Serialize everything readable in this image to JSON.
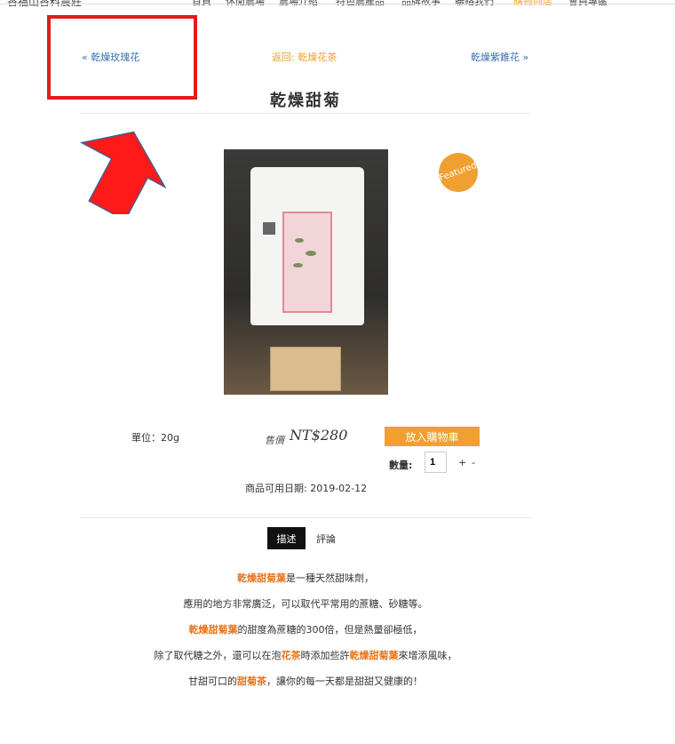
{
  "header": {
    "site_name": "香福山香料農莊",
    "nav": [
      "首頁",
      "休閒農場",
      "農場介紹",
      "特色農產品",
      "品牌故事",
      "聯絡我們",
      "購物商店",
      "會員專區"
    ],
    "active_nav": "購物商店"
  },
  "navigation": {
    "prev": "« 乾燥玫瑰花",
    "back": "返回: 乾燥花茶",
    "next": "乾燥紫錐花 »"
  },
  "product": {
    "title": "乾燥甜菊",
    "badge": "Featured",
    "unit": "單位：20g",
    "price_label": "售價",
    "price": "NT$280",
    "add_to_cart": "放入購物車",
    "qty_label": "數量:",
    "qty_value": "1",
    "qty_plus": "+",
    "qty_minus": "-",
    "available": "商品可用日期: 2019-02-12"
  },
  "tabs": {
    "description": "描述",
    "reviews": "評論"
  },
  "description": {
    "line1_a": "乾燥甜菊葉",
    "line1_b": "是一種天然甜味劑，",
    "line2": "應用的地方非常廣泛，可以取代平常用的蔗糖、砂糖等。",
    "line3_a": "乾燥甜菊葉",
    "line3_b": "的甜度為蔗糖的300倍，但是熱量卻極低，",
    "line4_a": "除了取代糖之外，還可以在泡",
    "line4_b": "花茶",
    "line4_c": "時添加些許",
    "line4_d": "乾燥甜菊葉",
    "line4_e": "來增添風味，",
    "line5_a": "甘甜可口的",
    "line5_b": "甜菊茶",
    "line5_c": "，讓你的每一天都是甜甜又健康的！"
  },
  "colors": {
    "accent": "#f0a030",
    "highlight": "#e8731a",
    "annotation": "#e21b1b",
    "link": "#3a6fb0"
  },
  "icons": {
    "annotation_arrow": "red-up-arrow-icon"
  }
}
